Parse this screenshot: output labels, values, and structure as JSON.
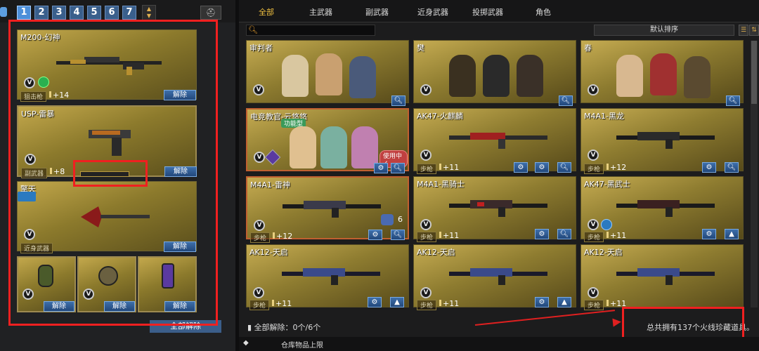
{
  "left": {
    "tabs": [
      "1",
      "2",
      "3",
      "4",
      "5",
      "6",
      "7"
    ],
    "slots": [
      {
        "name": "M200-幻神",
        "category": "狙击枪",
        "count": "+14",
        "button": "解除"
      },
      {
        "name": "USP-雷暴",
        "category": "副武器",
        "count": "+8",
        "button": "解除"
      },
      {
        "name": "擎天",
        "category": "近身武器",
        "button": "解除"
      }
    ],
    "grenades": [
      {
        "button": "解除"
      },
      {
        "button": "解除"
      },
      {
        "button": "解除"
      }
    ],
    "all_unload": "全部解除"
  },
  "right": {
    "filter_tabs": [
      "全部",
      "主武器",
      "副武器",
      "近身武器",
      "投掷武器",
      "角色"
    ],
    "sort": "默认排序",
    "cards": [
      {
        "name": "审判者"
      },
      {
        "name": "樊"
      },
      {
        "name": "春"
      },
      {
        "name": "电竞教官-云悠悠",
        "tag": "功能型",
        "status": "使用中✓"
      },
      {
        "name": "AK47-火麒麟",
        "category": "步枪",
        "count": "+11"
      },
      {
        "name": "M4A1-黑龙",
        "category": "步枪",
        "count": "+12"
      },
      {
        "name": "M4A1-雷神",
        "category": "步枪",
        "count": "+12",
        "badge": "6"
      },
      {
        "name": "M4A1-黑骑士",
        "category": "步枪",
        "count": "+11"
      },
      {
        "name": "AK47-黑武士",
        "category": "步枪",
        "count": "+11"
      },
      {
        "name": "AK12-天启",
        "category": "步枪",
        "count": "+11"
      },
      {
        "name": "AK12-天启",
        "category": "步枪",
        "count": "+11"
      },
      {
        "name": "AK12-天启",
        "category": "步枪",
        "count": "+11"
      }
    ],
    "summary_left": "全部解除：0个/6个",
    "summary_right": "总共拥有137个火线珍藏道具。",
    "bottom_label": "仓库物品上限"
  },
  "colors": {
    "accent": "#f0c040",
    "button": "#2d5a91",
    "highlight": "#f02020"
  }
}
